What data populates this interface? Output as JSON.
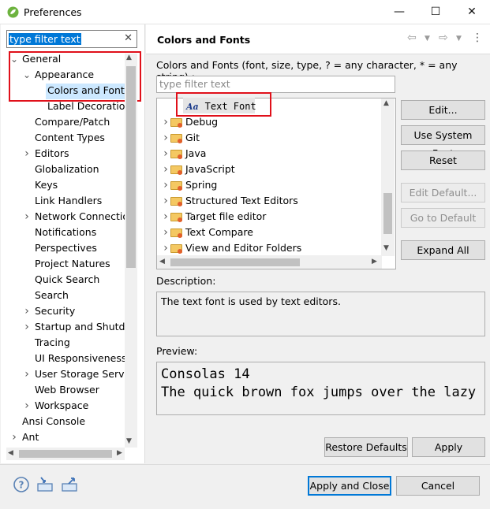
{
  "window": {
    "title": "Preferences",
    "minimize_glyph": "—",
    "maximize_glyph": "☐",
    "close_glyph": "✕"
  },
  "left": {
    "filter_value": "type filter text",
    "clear_glyph": "✕",
    "tree": [
      {
        "label": "General",
        "indent": 0,
        "twisty": "expanded"
      },
      {
        "label": "Appearance",
        "indent": 1,
        "twisty": "expanded"
      },
      {
        "label": "Colors and Fonts",
        "indent": 2,
        "twisty": "none",
        "selected": true
      },
      {
        "label": "Label Decorations",
        "indent": 2,
        "twisty": "none"
      },
      {
        "label": "Compare/Patch",
        "indent": 1,
        "twisty": "none"
      },
      {
        "label": "Content Types",
        "indent": 1,
        "twisty": "none"
      },
      {
        "label": "Editors",
        "indent": 1,
        "twisty": "collapsed"
      },
      {
        "label": "Globalization",
        "indent": 1,
        "twisty": "none"
      },
      {
        "label": "Keys",
        "indent": 1,
        "twisty": "none"
      },
      {
        "label": "Link Handlers",
        "indent": 1,
        "twisty": "none"
      },
      {
        "label": "Network Connections",
        "indent": 1,
        "twisty": "collapsed"
      },
      {
        "label": "Notifications",
        "indent": 1,
        "twisty": "none"
      },
      {
        "label": "Perspectives",
        "indent": 1,
        "twisty": "none"
      },
      {
        "label": "Project Natures",
        "indent": 1,
        "twisty": "none"
      },
      {
        "label": "Quick Search",
        "indent": 1,
        "twisty": "none"
      },
      {
        "label": "Search",
        "indent": 1,
        "twisty": "none"
      },
      {
        "label": "Security",
        "indent": 1,
        "twisty": "collapsed"
      },
      {
        "label": "Startup and Shutdown",
        "indent": 1,
        "twisty": "collapsed"
      },
      {
        "label": "Tracing",
        "indent": 1,
        "twisty": "none"
      },
      {
        "label": "UI Responsiveness",
        "indent": 1,
        "twisty": "none"
      },
      {
        "label": "User Storage Service",
        "indent": 1,
        "twisty": "collapsed"
      },
      {
        "label": "Web Browser",
        "indent": 1,
        "twisty": "none"
      },
      {
        "label": "Workspace",
        "indent": 1,
        "twisty": "collapsed"
      },
      {
        "label": "Ansi Console",
        "indent": 0,
        "twisty": "none"
      },
      {
        "label": "Ant",
        "indent": 0,
        "twisty": "collapsed"
      }
    ]
  },
  "right": {
    "page_title": "Colors and Fonts",
    "intro": "Colors and Fonts (font, size, type, ? = any character, * = any string) :",
    "filter_placeholder": "type filter text",
    "text_font_label": "Text Font",
    "text_font_icon": "Aa",
    "font_categories": [
      "Debug",
      "Git",
      "Java",
      "JavaScript",
      "Spring",
      "Structured Text Editors",
      "Target file editor",
      "Text Compare",
      "View and Editor Folders"
    ],
    "buttons": {
      "edit": "Edit...",
      "use_system_font": "Use System Font",
      "reset": "Reset",
      "edit_default": "Edit Default...",
      "go_to_default": "Go to Default",
      "expand_all": "Expand All",
      "restore_defaults": "Restore Defaults",
      "apply": "Apply"
    },
    "description_label": "Description:",
    "description_text": "The text font is used by text editors.",
    "preview_label": "Preview:",
    "preview_line1": "Consolas 14",
    "preview_line2": "The quick brown fox jumps over the lazy dog."
  },
  "bottom": {
    "apply_and_close": "Apply and Close",
    "cancel": "Cancel"
  },
  "colors": {
    "highlight_box": "#e0101a",
    "selection": "#cce8ff",
    "accent": "#0078d7"
  }
}
